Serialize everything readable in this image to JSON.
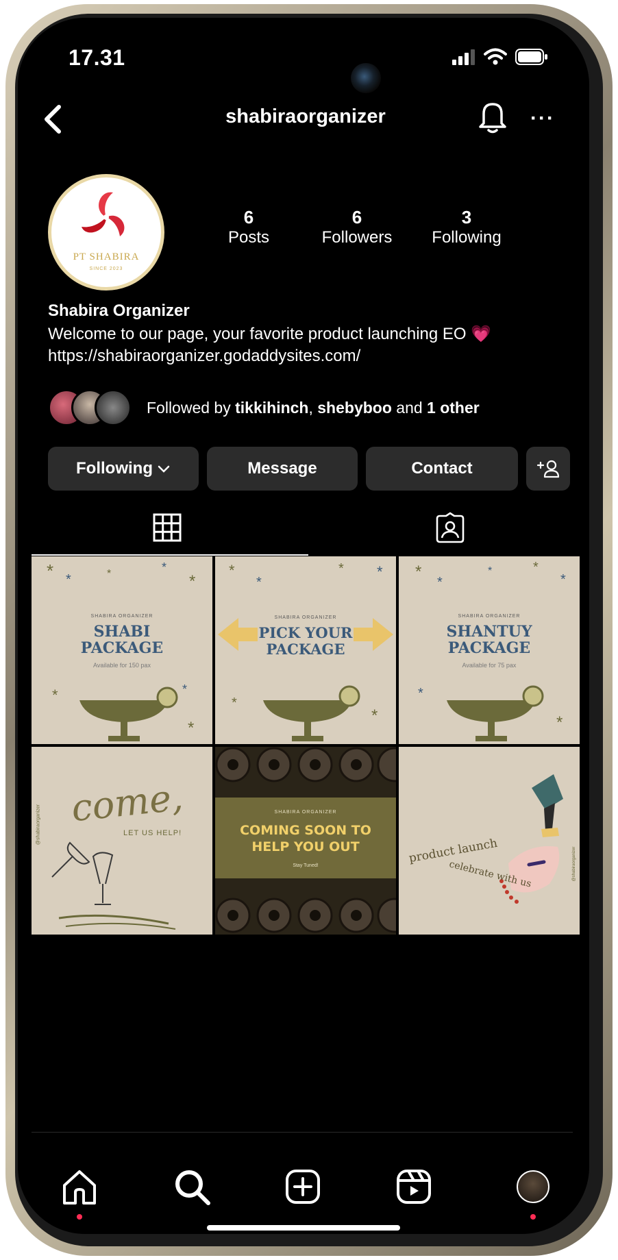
{
  "status_bar": {
    "time": "17.31",
    "icons": [
      "signal-icon",
      "wifi-icon",
      "battery-icon"
    ]
  },
  "header": {
    "username": "shabiraorganizer",
    "back_icon": "chevron-left-icon",
    "bell_icon": "bell-icon",
    "more_label": "···"
  },
  "profile": {
    "avatar_text": "PT SHABIRA",
    "avatar_subtext": "SINCE 2023",
    "stats": [
      {
        "num": "6",
        "label": "Posts"
      },
      {
        "num": "6",
        "label": "Followers"
      },
      {
        "num": "3",
        "label": "Following"
      }
    ],
    "display_name": "Shabira Organizer",
    "bio": "Welcome to our page, your favorite product launching EO 💗",
    "link": "https://shabiraorganizer.godaddysites.com/",
    "followed_by": {
      "prefix": "Followed by ",
      "user1": "tikkihinch",
      "sep": ", ",
      "user2": "shebyboo",
      "and": " and ",
      "others": "1 other"
    }
  },
  "buttons": {
    "following": "Following",
    "message": "Message",
    "contact": "Contact",
    "add_person_icon": "add-person-icon"
  },
  "tabs": {
    "grid_icon": "grid-icon",
    "tagged_icon": "tagged-icon",
    "active": "grid"
  },
  "posts": [
    {
      "brand": "SHABIRA ORGANIZER",
      "title1": "SHABI",
      "title2": "PACKAGE",
      "sub": "Available for 150 pax"
    },
    {
      "brand": "SHABIRA ORGANIZER",
      "title1": "PICK YOUR",
      "title2": "PACKAGE"
    },
    {
      "brand": "SHABIRA ORGANIZER",
      "title1": "SHANTUY",
      "title2": "PACKAGE",
      "sub": "Available for 75 pax"
    },
    {
      "handle": "@shabiraorganizer",
      "script": "come,",
      "line": "LET US HELP!"
    },
    {
      "brand": "SHABIRA ORGANIZER",
      "title1": "COMING SOON TO",
      "title2": "HELP YOU OUT",
      "sub": "Stay Tuned!"
    },
    {
      "script1": "product launch",
      "script2": "celebrate with us",
      "handle": "@shabiraorganizer"
    }
  ],
  "bottom_nav": [
    "home-icon",
    "search-icon",
    "create-icon",
    "reels-icon",
    "profile-icon"
  ],
  "colors": {
    "background": "#000000",
    "button": "#2c2c2c",
    "post_bg": "#d9cfbe",
    "post_title": "#3b5a7a",
    "accent_yellow": "#e9c46a",
    "notif_dot": "#ff2d55"
  }
}
